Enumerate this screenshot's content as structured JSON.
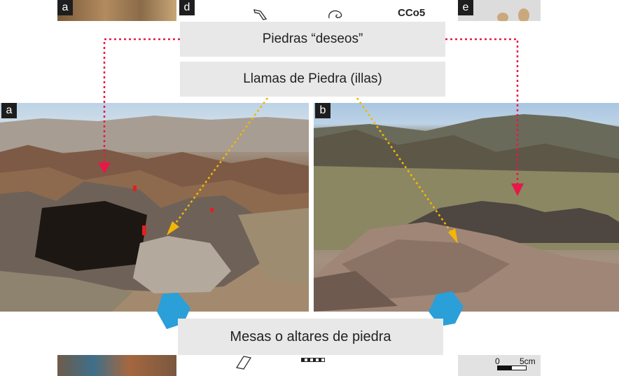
{
  "panels": {
    "a": "a",
    "b": "b",
    "d": "d",
    "e": "e"
  },
  "top_strip": {
    "site_code": "CCo5"
  },
  "labels": {
    "deseos": "Piedras “deseos”",
    "llamas": "Llamas de Piedra (illas)",
    "mesas": "Mesas o altares de piedra"
  },
  "scale_bar": {
    "zero": "0",
    "five": "5cm"
  },
  "colors": {
    "red_arrow": "#e8174a",
    "yellow_arrow": "#f2b705",
    "blue_arrow": "#2b9fd8",
    "label_bg": "#e8e8e8"
  },
  "icons": [
    "red-dotted-arrow-icon",
    "yellow-dotted-arrow-icon",
    "blue-block-arrow-icon",
    "scale-bar-icon"
  ]
}
